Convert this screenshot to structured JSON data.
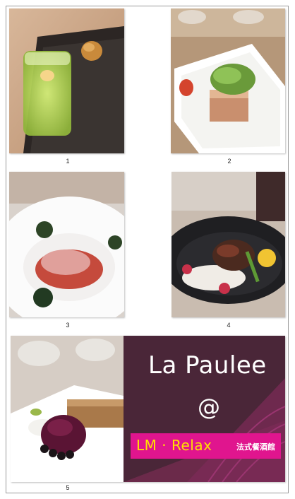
{
  "gallery": {
    "captions": [
      "1",
      "2",
      "3",
      "4",
      "5"
    ]
  },
  "banner": {
    "title": "La Paulee",
    "at": "@",
    "brand": "LM · Relax",
    "brand_sub": "法式餐酒館"
  },
  "colors": {
    "frame_border": "#9a9a9a",
    "banner_bg": "#6b2a4a",
    "brand_bar": "#e0158e",
    "brand_text": "#ffe200"
  }
}
